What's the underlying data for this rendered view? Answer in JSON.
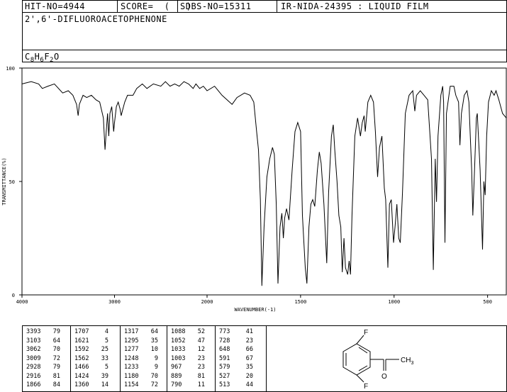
{
  "header": {
    "hit_no": "HIT-NO=4944",
    "score": "SCORE=  (   )",
    "sdbs_no": "SDBS-NO=15311",
    "ir_info": "IR-NIDA-24395 : LIQUID FILM",
    "compound_name": "2',6'-DIFLUOROACETOPHENONE",
    "formula": "C8H6F2O"
  },
  "chart_data": {
    "type": "line",
    "title": "",
    "xlabel": "WAVENUMBER(-1)",
    "ylabel": "TRANSMITTANCE(%)",
    "xlim": [
      4000,
      400
    ],
    "ylim": [
      0,
      100
    ],
    "x_ticks": [
      "4000",
      "3000",
      "2000",
      "1500",
      "1000",
      "500"
    ],
    "y_ticks": [
      "100",
      "50",
      "0"
    ],
    "series": [
      {
        "points": [
          [
            4000,
            93
          ],
          [
            3900,
            94
          ],
          [
            3820,
            93
          ],
          [
            3780,
            91
          ],
          [
            3720,
            92
          ],
          [
            3650,
            93
          ],
          [
            3560,
            89
          ],
          [
            3500,
            90
          ],
          [
            3450,
            88
          ],
          [
            3410,
            84
          ],
          [
            3393,
            79
          ],
          [
            3380,
            84
          ],
          [
            3340,
            88
          ],
          [
            3300,
            87
          ],
          [
            3250,
            88
          ],
          [
            3200,
            86
          ],
          [
            3160,
            85
          ],
          [
            3120,
            78
          ],
          [
            3103,
            64
          ],
          [
            3090,
            72
          ],
          [
            3075,
            80
          ],
          [
            3062,
            70
          ],
          [
            3050,
            80
          ],
          [
            3030,
            83
          ],
          [
            3009,
            72
          ],
          [
            3000,
            76
          ],
          [
            2980,
            83
          ],
          [
            2960,
            85
          ],
          [
            2940,
            82
          ],
          [
            2928,
            79
          ],
          [
            2916,
            81
          ],
          [
            2890,
            85
          ],
          [
            2860,
            88
          ],
          [
            2800,
            88
          ],
          [
            2760,
            91
          ],
          [
            2700,
            93
          ],
          [
            2650,
            91
          ],
          [
            2580,
            93
          ],
          [
            2500,
            92
          ],
          [
            2450,
            94
          ],
          [
            2400,
            92
          ],
          [
            2350,
            93
          ],
          [
            2300,
            92
          ],
          [
            2250,
            94
          ],
          [
            2200,
            93
          ],
          [
            2150,
            91
          ],
          [
            2120,
            93
          ],
          [
            2080,
            91
          ],
          [
            2040,
            92
          ],
          [
            2000,
            90
          ],
          [
            1960,
            92
          ],
          [
            1920,
            88
          ],
          [
            1866,
            84
          ],
          [
            1840,
            87
          ],
          [
            1800,
            89
          ],
          [
            1770,
            88
          ],
          [
            1750,
            85
          ],
          [
            1735,
            72
          ],
          [
            1725,
            64
          ],
          [
            1715,
            42
          ],
          [
            1707,
            4
          ],
          [
            1695,
            30
          ],
          [
            1680,
            52
          ],
          [
            1665,
            60
          ],
          [
            1650,
            65
          ],
          [
            1640,
            62
          ],
          [
            1630,
            40
          ],
          [
            1621,
            5
          ],
          [
            1610,
            30
          ],
          [
            1600,
            36
          ],
          [
            1592,
            25
          ],
          [
            1585,
            34
          ],
          [
            1575,
            38
          ],
          [
            1562,
            33
          ],
          [
            1545,
            55
          ],
          [
            1530,
            72
          ],
          [
            1515,
            76
          ],
          [
            1500,
            72
          ],
          [
            1490,
            35
          ],
          [
            1480,
            20
          ],
          [
            1475,
            12
          ],
          [
            1466,
            5
          ],
          [
            1455,
            30
          ],
          [
            1445,
            40
          ],
          [
            1435,
            42
          ],
          [
            1424,
            39
          ],
          [
            1410,
            55
          ],
          [
            1400,
            63
          ],
          [
            1390,
            58
          ],
          [
            1375,
            40
          ],
          [
            1360,
            14
          ],
          [
            1350,
            45
          ],
          [
            1335,
            70
          ],
          [
            1325,
            75
          ],
          [
            1317,
            64
          ],
          [
            1305,
            50
          ],
          [
            1295,
            35
          ],
          [
            1285,
            30
          ],
          [
            1277,
            10
          ],
          [
            1268,
            25
          ],
          [
            1260,
            12
          ],
          [
            1248,
            9
          ],
          [
            1240,
            15
          ],
          [
            1233,
            9
          ],
          [
            1225,
            35
          ],
          [
            1210,
            70
          ],
          [
            1195,
            78
          ],
          [
            1180,
            70
          ],
          [
            1170,
            76
          ],
          [
            1160,
            79
          ],
          [
            1154,
            72
          ],
          [
            1140,
            85
          ],
          [
            1125,
            88
          ],
          [
            1110,
            85
          ],
          [
            1100,
            72
          ],
          [
            1088,
            52
          ],
          [
            1078,
            65
          ],
          [
            1065,
            70
          ],
          [
            1052,
            47
          ],
          [
            1045,
            42
          ],
          [
            1033,
            12
          ],
          [
            1025,
            40
          ],
          [
            1015,
            42
          ],
          [
            1003,
            23
          ],
          [
            995,
            30
          ],
          [
            985,
            40
          ],
          [
            975,
            25
          ],
          [
            967,
            23
          ],
          [
            955,
            45
          ],
          [
            940,
            80
          ],
          [
            920,
            88
          ],
          [
            900,
            90
          ],
          [
            889,
            81
          ],
          [
            880,
            88
          ],
          [
            860,
            90
          ],
          [
            840,
            88
          ],
          [
            820,
            86
          ],
          [
            800,
            60
          ],
          [
            790,
            11
          ],
          [
            780,
            60
          ],
          [
            773,
            41
          ],
          [
            765,
            70
          ],
          [
            750,
            88
          ],
          [
            740,
            92
          ],
          [
            735,
            85
          ],
          [
            728,
            23
          ],
          [
            720,
            80
          ],
          [
            700,
            92
          ],
          [
            680,
            92
          ],
          [
            670,
            88
          ],
          [
            655,
            85
          ],
          [
            648,
            66
          ],
          [
            640,
            80
          ],
          [
            625,
            88
          ],
          [
            610,
            90
          ],
          [
            600,
            85
          ],
          [
            591,
            67
          ],
          [
            585,
            55
          ],
          [
            579,
            35
          ],
          [
            570,
            55
          ],
          [
            560,
            78
          ],
          [
            555,
            80
          ],
          [
            540,
            55
          ],
          [
            527,
            20
          ],
          [
            520,
            50
          ],
          [
            513,
            44
          ],
          [
            505,
            70
          ],
          [
            495,
            85
          ],
          [
            480,
            90
          ],
          [
            465,
            88
          ],
          [
            455,
            90
          ],
          [
            440,
            86
          ],
          [
            420,
            80
          ],
          [
            400,
            78
          ]
        ]
      }
    ]
  },
  "peak_table": {
    "columns": [
      [
        [
          "3393",
          "79"
        ],
        [
          "3103",
          "64"
        ],
        [
          "3062",
          "70"
        ],
        [
          "3009",
          "72"
        ],
        [
          "2928",
          "79"
        ],
        [
          "2916",
          "81"
        ],
        [
          "1866",
          "84"
        ]
      ],
      [
        [
          "1707",
          "4"
        ],
        [
          "1621",
          "5"
        ],
        [
          "1592",
          "25"
        ],
        [
          "1562",
          "33"
        ],
        [
          "1466",
          "5"
        ],
        [
          "1424",
          "39"
        ],
        [
          "1360",
          "14"
        ]
      ],
      [
        [
          "1317",
          "64"
        ],
        [
          "1295",
          "35"
        ],
        [
          "1277",
          "10"
        ],
        [
          "1248",
          "9"
        ],
        [
          "1233",
          "9"
        ],
        [
          "1180",
          "70"
        ],
        [
          "1154",
          "72"
        ]
      ],
      [
        [
          "1088",
          "52"
        ],
        [
          "1052",
          "47"
        ],
        [
          "1033",
          "12"
        ],
        [
          "1003",
          "23"
        ],
        [
          "967",
          "23"
        ],
        [
          "889",
          "81"
        ],
        [
          "790",
          "11"
        ]
      ],
      [
        [
          "773",
          "41"
        ],
        [
          "728",
          "23"
        ],
        [
          "648",
          "66"
        ],
        [
          "591",
          "67"
        ],
        [
          "579",
          "35"
        ],
        [
          "527",
          "20"
        ],
        [
          "513",
          "44"
        ]
      ]
    ]
  },
  "structure": {
    "atom_f_top": "F",
    "atom_f_bottom": "F",
    "atom_o": "O",
    "group_ch3": "CH3"
  }
}
